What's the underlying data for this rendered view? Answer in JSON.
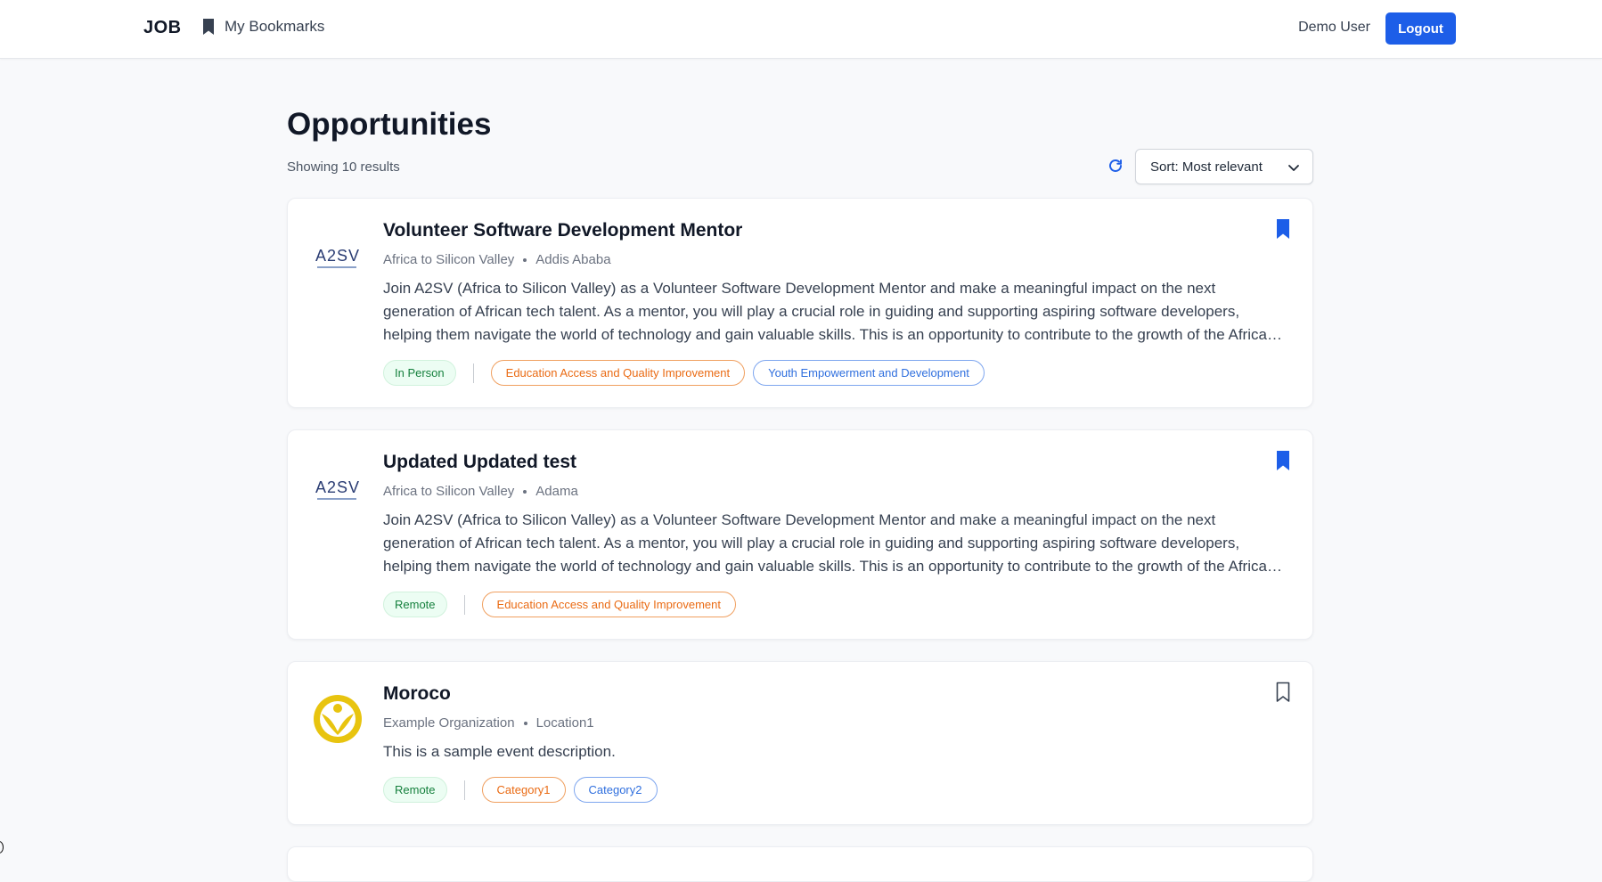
{
  "navbar": {
    "brand": "JOB",
    "bookmarks_label": "My Bookmarks",
    "user_name": "Demo User",
    "logout_label": "Logout"
  },
  "main": {
    "title": "Opportunities",
    "results_text": "Showing 10 results",
    "sort_label": "Sort: Most relevant"
  },
  "colors": {
    "primary": "#1d5ee8",
    "mode_tag_bg": "#ecfdf3",
    "mode_tag_text": "#15803d",
    "category_orange": "#ea6b14",
    "category_blue": "#2f6fde"
  },
  "cards": [
    {
      "title": "Volunteer Software Development Mentor",
      "organization": "Africa to Silicon Valley",
      "location": "Addis Ababa",
      "description": "Join A2SV (Africa to Silicon Valley) as a Volunteer Software Development Mentor and make a meaningful impact on the next generation of African tech talent. As a mentor, you will play a crucial role in guiding and supporting aspiring software developers, helping them navigate the world of technology and gain valuable skills. This is an opportunity to contribute to the growth of the African tech ecosystem.",
      "mode": "In Person",
      "categories": [
        "Education Access and Quality Improvement",
        "Youth Empowerment and Development"
      ],
      "logo": "A2SV",
      "bookmarked": true
    },
    {
      "title": "Updated Updated test",
      "organization": "Africa to Silicon Valley",
      "location": "Adama",
      "description": "Join A2SV (Africa to Silicon Valley) as a Volunteer Software Development Mentor and make a meaningful impact on the next generation of African tech talent. As a mentor, you will play a crucial role in guiding and supporting aspiring software developers, helping them navigate the world of technology and gain valuable skills. This is an opportunity to contribute to the growth of the African tech ecosystem.",
      "mode": "Remote",
      "categories": [
        "Education Access and Quality Improvement"
      ],
      "logo": "A2SV",
      "bookmarked": true
    },
    {
      "title": "Moroco",
      "organization": "Example Organization",
      "location": "Location1",
      "description": "This is a sample event description.",
      "mode": "Remote",
      "categories": [
        "Category1",
        "Category2"
      ],
      "logo": "yellow-person-emblem",
      "bookmarked": false
    }
  ]
}
